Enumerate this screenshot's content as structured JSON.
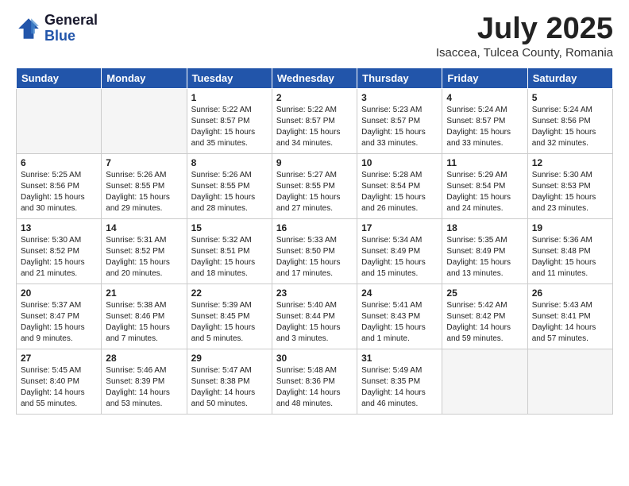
{
  "header": {
    "logo_general": "General",
    "logo_blue": "Blue",
    "month_title": "July 2025",
    "subtitle": "Isaccea, Tulcea County, Romania"
  },
  "weekdays": [
    "Sunday",
    "Monday",
    "Tuesday",
    "Wednesday",
    "Thursday",
    "Friday",
    "Saturday"
  ],
  "weeks": [
    [
      {
        "day": "",
        "empty": true
      },
      {
        "day": "",
        "empty": true
      },
      {
        "day": "1",
        "sunrise": "Sunrise: 5:22 AM",
        "sunset": "Sunset: 8:57 PM",
        "daylight": "Daylight: 15 hours and 35 minutes."
      },
      {
        "day": "2",
        "sunrise": "Sunrise: 5:22 AM",
        "sunset": "Sunset: 8:57 PM",
        "daylight": "Daylight: 15 hours and 34 minutes."
      },
      {
        "day": "3",
        "sunrise": "Sunrise: 5:23 AM",
        "sunset": "Sunset: 8:57 PM",
        "daylight": "Daylight: 15 hours and 33 minutes."
      },
      {
        "day": "4",
        "sunrise": "Sunrise: 5:24 AM",
        "sunset": "Sunset: 8:57 PM",
        "daylight": "Daylight: 15 hours and 33 minutes."
      },
      {
        "day": "5",
        "sunrise": "Sunrise: 5:24 AM",
        "sunset": "Sunset: 8:56 PM",
        "daylight": "Daylight: 15 hours and 32 minutes."
      }
    ],
    [
      {
        "day": "6",
        "sunrise": "Sunrise: 5:25 AM",
        "sunset": "Sunset: 8:56 PM",
        "daylight": "Daylight: 15 hours and 30 minutes."
      },
      {
        "day": "7",
        "sunrise": "Sunrise: 5:26 AM",
        "sunset": "Sunset: 8:55 PM",
        "daylight": "Daylight: 15 hours and 29 minutes."
      },
      {
        "day": "8",
        "sunrise": "Sunrise: 5:26 AM",
        "sunset": "Sunset: 8:55 PM",
        "daylight": "Daylight: 15 hours and 28 minutes."
      },
      {
        "day": "9",
        "sunrise": "Sunrise: 5:27 AM",
        "sunset": "Sunset: 8:55 PM",
        "daylight": "Daylight: 15 hours and 27 minutes."
      },
      {
        "day": "10",
        "sunrise": "Sunrise: 5:28 AM",
        "sunset": "Sunset: 8:54 PM",
        "daylight": "Daylight: 15 hours and 26 minutes."
      },
      {
        "day": "11",
        "sunrise": "Sunrise: 5:29 AM",
        "sunset": "Sunset: 8:54 PM",
        "daylight": "Daylight: 15 hours and 24 minutes."
      },
      {
        "day": "12",
        "sunrise": "Sunrise: 5:30 AM",
        "sunset": "Sunset: 8:53 PM",
        "daylight": "Daylight: 15 hours and 23 minutes."
      }
    ],
    [
      {
        "day": "13",
        "sunrise": "Sunrise: 5:30 AM",
        "sunset": "Sunset: 8:52 PM",
        "daylight": "Daylight: 15 hours and 21 minutes."
      },
      {
        "day": "14",
        "sunrise": "Sunrise: 5:31 AM",
        "sunset": "Sunset: 8:52 PM",
        "daylight": "Daylight: 15 hours and 20 minutes."
      },
      {
        "day": "15",
        "sunrise": "Sunrise: 5:32 AM",
        "sunset": "Sunset: 8:51 PM",
        "daylight": "Daylight: 15 hours and 18 minutes."
      },
      {
        "day": "16",
        "sunrise": "Sunrise: 5:33 AM",
        "sunset": "Sunset: 8:50 PM",
        "daylight": "Daylight: 15 hours and 17 minutes."
      },
      {
        "day": "17",
        "sunrise": "Sunrise: 5:34 AM",
        "sunset": "Sunset: 8:49 PM",
        "daylight": "Daylight: 15 hours and 15 minutes."
      },
      {
        "day": "18",
        "sunrise": "Sunrise: 5:35 AM",
        "sunset": "Sunset: 8:49 PM",
        "daylight": "Daylight: 15 hours and 13 minutes."
      },
      {
        "day": "19",
        "sunrise": "Sunrise: 5:36 AM",
        "sunset": "Sunset: 8:48 PM",
        "daylight": "Daylight: 15 hours and 11 minutes."
      }
    ],
    [
      {
        "day": "20",
        "sunrise": "Sunrise: 5:37 AM",
        "sunset": "Sunset: 8:47 PM",
        "daylight": "Daylight: 15 hours and 9 minutes."
      },
      {
        "day": "21",
        "sunrise": "Sunrise: 5:38 AM",
        "sunset": "Sunset: 8:46 PM",
        "daylight": "Daylight: 15 hours and 7 minutes."
      },
      {
        "day": "22",
        "sunrise": "Sunrise: 5:39 AM",
        "sunset": "Sunset: 8:45 PM",
        "daylight": "Daylight: 15 hours and 5 minutes."
      },
      {
        "day": "23",
        "sunrise": "Sunrise: 5:40 AM",
        "sunset": "Sunset: 8:44 PM",
        "daylight": "Daylight: 15 hours and 3 minutes."
      },
      {
        "day": "24",
        "sunrise": "Sunrise: 5:41 AM",
        "sunset": "Sunset: 8:43 PM",
        "daylight": "Daylight: 15 hours and 1 minute."
      },
      {
        "day": "25",
        "sunrise": "Sunrise: 5:42 AM",
        "sunset": "Sunset: 8:42 PM",
        "daylight": "Daylight: 14 hours and 59 minutes."
      },
      {
        "day": "26",
        "sunrise": "Sunrise: 5:43 AM",
        "sunset": "Sunset: 8:41 PM",
        "daylight": "Daylight: 14 hours and 57 minutes."
      }
    ],
    [
      {
        "day": "27",
        "sunrise": "Sunrise: 5:45 AM",
        "sunset": "Sunset: 8:40 PM",
        "daylight": "Daylight: 14 hours and 55 minutes."
      },
      {
        "day": "28",
        "sunrise": "Sunrise: 5:46 AM",
        "sunset": "Sunset: 8:39 PM",
        "daylight": "Daylight: 14 hours and 53 minutes."
      },
      {
        "day": "29",
        "sunrise": "Sunrise: 5:47 AM",
        "sunset": "Sunset: 8:38 PM",
        "daylight": "Daylight: 14 hours and 50 minutes."
      },
      {
        "day": "30",
        "sunrise": "Sunrise: 5:48 AM",
        "sunset": "Sunset: 8:36 PM",
        "daylight": "Daylight: 14 hours and 48 minutes."
      },
      {
        "day": "31",
        "sunrise": "Sunrise: 5:49 AM",
        "sunset": "Sunset: 8:35 PM",
        "daylight": "Daylight: 14 hours and 46 minutes."
      },
      {
        "day": "",
        "empty": true
      },
      {
        "day": "",
        "empty": true
      }
    ]
  ]
}
